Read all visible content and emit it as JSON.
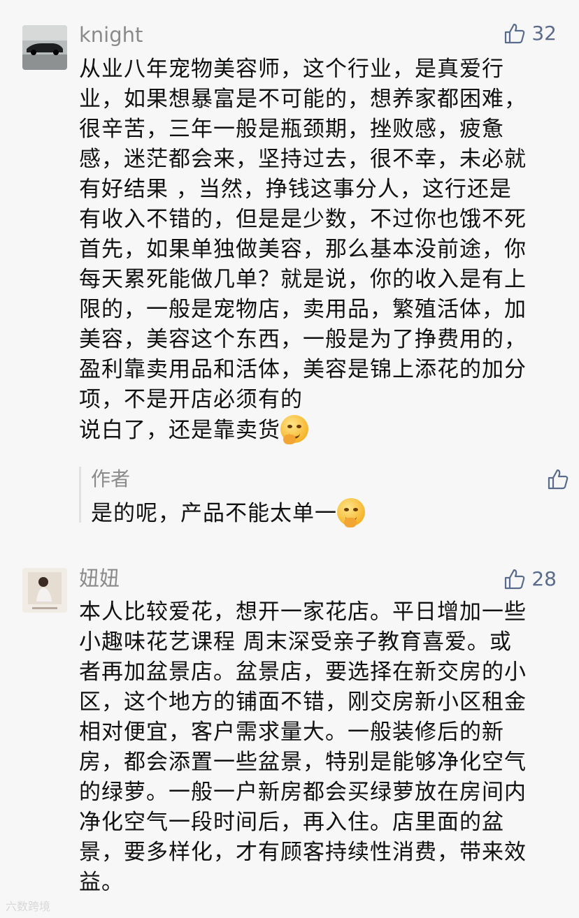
{
  "comments": [
    {
      "username": "knight",
      "likes": "32",
      "lines": [
        "从业八年宠物美容师，这个行业，是真爱行",
        "业，如果想暴富是不可能的，想养家都困难，",
        "很辛苦，三年一般是瓶颈期，挫败感，疲惫",
        "感，迷茫都会来，坚持过去，很不幸，未必就",
        "有好结果 ，当然，挣钱这事分人，这行还是",
        "有收入不错的，但是是少数，不过你也饿不死",
        "首先，如果单独做美容，那么基本没前途，你",
        "每天累死能做几单？就是说，你的收入是有上",
        "限的，一般是宠物店，卖用品，繁殖活体，加",
        "美容，美容这个东西，一般是为了挣费用的，",
        "盈利靠卖用品和活体，美容是锦上添花的加分",
        "项，不是开店必须有的",
        "说白了，还是靠卖货"
      ],
      "reply": {
        "author": "作者",
        "text": "是的呢，产品不能太单一"
      }
    },
    {
      "username": "妞妞",
      "likes": "28",
      "lines": [
        "本人比较爱花，想开一家花店。平日增加一些",
        "小趣味花艺课程 周末深受亲子教育喜爱。或",
        "者再加盆景店。盆景店，要选择在新交房的小",
        "区，这个地方的铺面不错，刚交房新小区租金",
        "相对便宜，客户需求量大。一般装修后的新",
        "房，都会添置一些盆景，特别是能够净化空气",
        "的绿萝。一般一户新房都会买绿萝放在房间内",
        "净化空气一段时间后，再入住。店里面的盆",
        "景，要多样化，才有顾客持续性消费，带来效",
        "益。"
      ]
    }
  ],
  "watermark": "六数跨境",
  "colors": {
    "accent": "#5a6b8c",
    "text": "#111111",
    "muted": "#8a8a8a",
    "background": "#f7f7f7"
  }
}
